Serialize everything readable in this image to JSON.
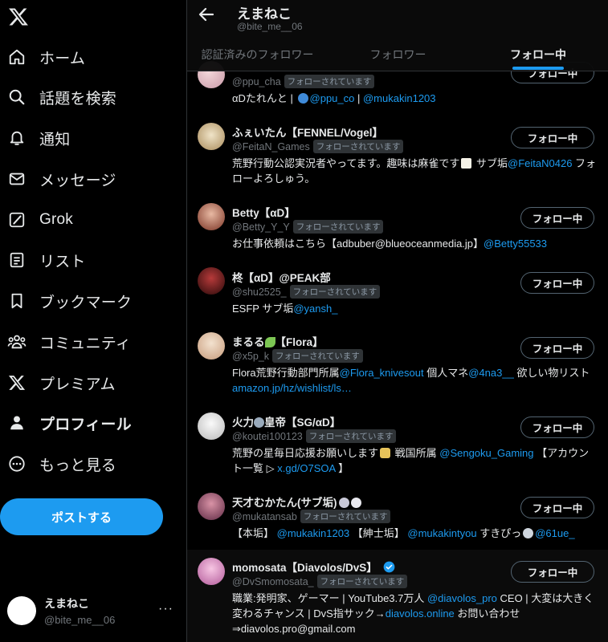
{
  "sidebar": {
    "nav": [
      {
        "label": "ホーム",
        "icon": "home-icon"
      },
      {
        "label": "話題を検索",
        "icon": "search-icon"
      },
      {
        "label": "通知",
        "icon": "bell-icon"
      },
      {
        "label": "メッセージ",
        "icon": "mail-icon"
      },
      {
        "label": "Grok",
        "icon": "grok-icon"
      },
      {
        "label": "リスト",
        "icon": "list-icon"
      },
      {
        "label": "ブックマーク",
        "icon": "bookmark-icon"
      },
      {
        "label": "コミュニティ",
        "icon": "community-icon"
      },
      {
        "label": "プレミアム",
        "icon": "x-premium-icon"
      },
      {
        "label": "プロフィール",
        "icon": "profile-icon"
      },
      {
        "label": "もっと見る",
        "icon": "more-circle-icon"
      }
    ],
    "post_button": "ポストする",
    "account": {
      "name": "えまねこ",
      "handle": "@bite_me__06",
      "more": "···"
    }
  },
  "header": {
    "name": "えまねこ",
    "handle": "@bite_me__06",
    "tabs": [
      {
        "label": "認証済みのフォロワー"
      },
      {
        "label": "フォロワー"
      },
      {
        "label": "フォロー中"
      }
    ],
    "active_tab": "フォロー中"
  },
  "follows_badge": "フォローされています",
  "follow_button": "フォロー中",
  "users": [
    {
      "handle": "@ppu_cha",
      "bio": [
        {
          "t": "αDたれんと | "
        },
        {
          "emoji": "globe"
        },
        {
          "t": "@ppu_co",
          "link": true
        },
        {
          "t": " | "
        },
        {
          "t": "@mukakin1203",
          "link": true
        }
      ]
    },
    {
      "name": "ふぇいたん【FENNEL/Vogel】",
      "handle": "@FeitaN_Games",
      "bio": [
        {
          "t": "荒野行動公認実況者やってます。趣味は麻雀です"
        },
        {
          "emoji": "mahjong"
        },
        {
          "t": " サブ垢"
        },
        {
          "t": "@FeitaN0426",
          "link": true
        },
        {
          "t": " フォローよろしゅう。"
        }
      ]
    },
    {
      "name": "Betty【αD】",
      "handle": "@Betty_Y_Y",
      "bio": [
        {
          "t": "お仕事依頼はこちら【adbuber@blueoceanmedia.jp】"
        },
        {
          "t": "@Betty55533",
          "link": true
        }
      ]
    },
    {
      "name": "柊【αD】@PEAK部",
      "handle": "@shu2525_",
      "bio": [
        {
          "t": "ESFP サブ垢"
        },
        {
          "t": "@yansh_",
          "link": true
        }
      ]
    },
    {
      "name": "まるる【Flora】",
      "name_emoji": "leaf",
      "handle": "@x5p_k",
      "bio": [
        {
          "t": "Flora荒野行動部門所属"
        },
        {
          "t": "@Flora_knivesout",
          "link": true
        },
        {
          "t": " 個人マネ"
        },
        {
          "t": "@4na3__",
          "link": true
        },
        {
          "t": " 欲しい物リスト "
        },
        {
          "t": "amazon.jp/hz/wishlist/ls…",
          "link": true
        }
      ]
    },
    {
      "name": "火力皇帝【SG/αD】",
      "name_emoji": "dragon",
      "handle": "@koutei100123",
      "bio": [
        {
          "t": "荒野の星毎日応援お願いします"
        },
        {
          "emoji": "star3"
        },
        {
          "t": " 戦国所属 "
        },
        {
          "t": "@Sengoku_Gaming",
          "link": true
        },
        {
          "t": " 【アカウント一覧 ▷ "
        },
        {
          "t": "x.gd/O7SOA",
          "link": true
        },
        {
          "t": " 】"
        }
      ]
    },
    {
      "name": "天才むかたん(サブ垢)",
      "name_emoji": "rabbits",
      "handle": "@mukatansab",
      "bio": [
        {
          "t": "【本垢】 "
        },
        {
          "t": "@mukakin1203",
          "link": true
        },
        {
          "t": " 【紳士垢】 "
        },
        {
          "t": "@mukakintyou",
          "link": true
        },
        {
          "t": " すきぴっ"
        },
        {
          "emoji": "ring"
        },
        {
          "t": "@61ue_",
          "link": true
        }
      ]
    },
    {
      "name": "momosata【Diavolos/DvS】",
      "verified": true,
      "handle": "@DvSmomosata_",
      "bio": [
        {
          "t": "職業:発明家、ゲーマー | YouTube3.7万人 "
        },
        {
          "t": "@diavolos_pro",
          "link": true
        },
        {
          "t": " CEO | 大変は大きく変わるチャンス | DvS指サック→"
        },
        {
          "t": "diavolos.online",
          "link": true
        },
        {
          "t": " お問い合わせ ⇒diavolos.pro@gmail.com"
        }
      ]
    }
  ],
  "colors": {
    "accent": "#1d9bf0",
    "text": "#e7e9ea",
    "muted": "#71767b",
    "border": "#2f3336"
  }
}
